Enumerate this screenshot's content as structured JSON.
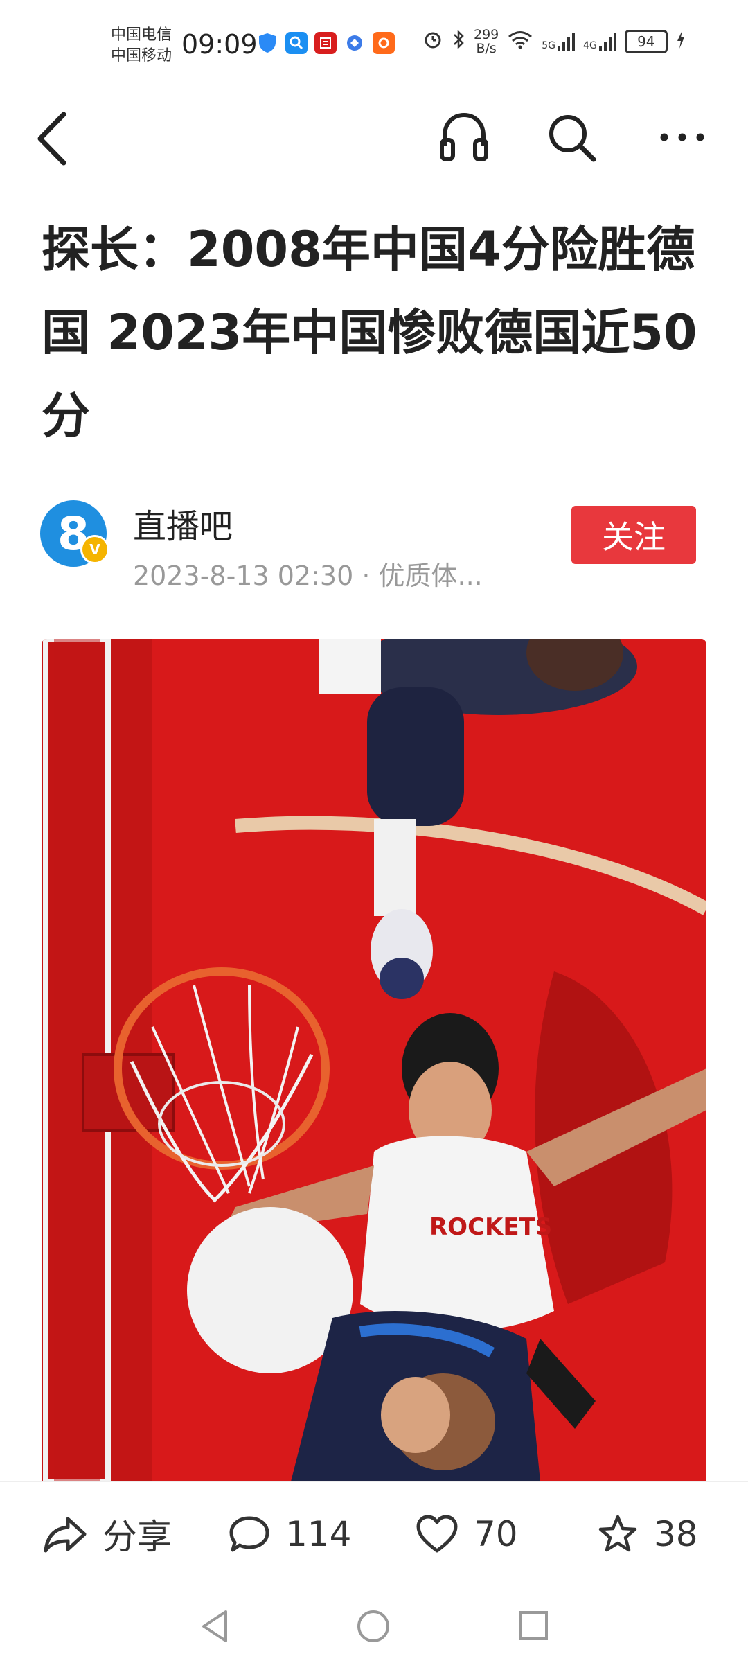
{
  "status_bar": {
    "carrier_1": "中国电信",
    "carrier_2": "中国移动",
    "time": "09:09",
    "net_speed_value": "299",
    "net_speed_unit": "B/s",
    "signal_1": "5G",
    "signal_2": "4G",
    "battery": "94",
    "notification_icons": [
      "shield-icon",
      "search-app-icon",
      "news-app-icon",
      "browser-app-icon",
      "taobao-app-icon"
    ]
  },
  "nav": {
    "icons": [
      "back-arrow-icon",
      "headphone-icon",
      "search-icon",
      "more-dots-icon"
    ]
  },
  "article": {
    "title": "探长：2008年中国4分险胜德国 2023年中国惨败德国近50分",
    "author": {
      "avatar_text": "8",
      "badge_text": "V",
      "name": "直播吧",
      "meta": "2023-8-13 02:30 · 优质体..."
    },
    "follow_label": "关注"
  },
  "actions": {
    "share_label": "分享",
    "comment_count": "114",
    "like_count": "70",
    "fav_count": "38"
  },
  "colors": {
    "follow_bg": "#e8383d",
    "court_red": "#d8191a",
    "avatar_blue": "#1f8fe0"
  }
}
